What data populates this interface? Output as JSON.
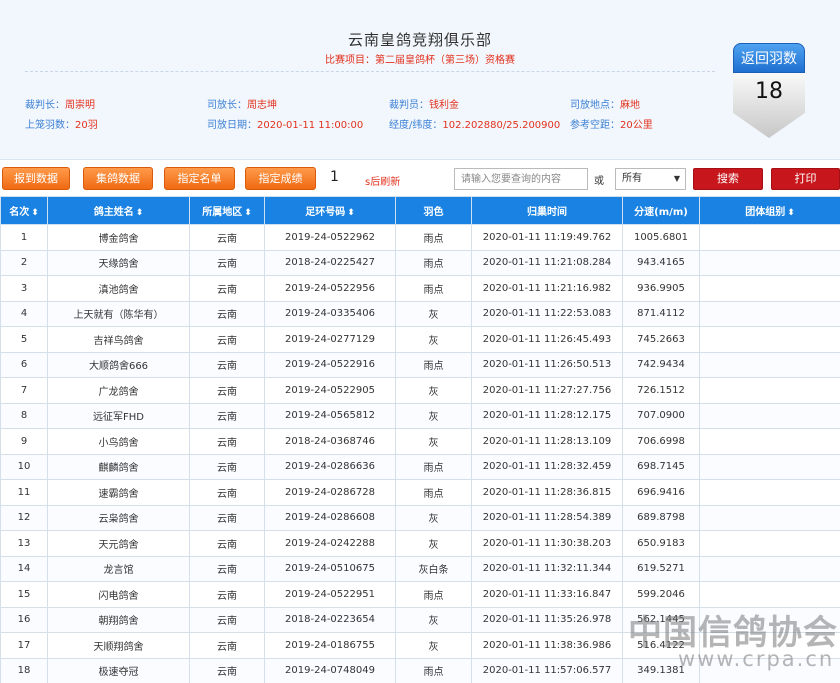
{
  "header": {
    "club_title": "云南皇鸽竞翔俱乐部",
    "race_name": "比赛项目：第二届皇鸽杯（第三场）资格赛",
    "info_row1": [
      {
        "key": "裁判长：",
        "value": "周崇明"
      },
      {
        "key": "司放长：",
        "value": "周志坤"
      },
      {
        "key": "裁判员：",
        "value": "钱利金"
      },
      {
        "key": "司放地点：",
        "value": "麻地"
      }
    ],
    "info_row2": [
      {
        "key": "上笼羽数：",
        "value": "20羽"
      },
      {
        "key": "司放日期：",
        "value": "2020-01-11 11:00:00"
      },
      {
        "key": "经度/纬度：",
        "value": "102.202880/25.200900"
      },
      {
        "key": "参考空距：",
        "value": "20公里"
      }
    ]
  },
  "badge": {
    "label": "返回羽数",
    "count": "18"
  },
  "toolbar": {
    "buttons": [
      "报到数据",
      "集鸽数据",
      "指定名单",
      "指定成绩"
    ],
    "counter": "1",
    "refresh_label": "s后刷新",
    "search_placeholder": "请输入您要查询的内容",
    "or_label": "或",
    "select_value": "所有",
    "search_button": "搜索",
    "print_button": "打印"
  },
  "table": {
    "columns": [
      "名次",
      "鸽主姓名",
      "所属地区",
      "足环号码",
      "羽色",
      "归巢时间",
      "分速(m/m)",
      "团体组别"
    ],
    "sortable": [
      true,
      true,
      true,
      true,
      false,
      false,
      false,
      true
    ],
    "rows": [
      [
        "1",
        "博金鸽舍",
        "云南",
        "2019-24-0522962",
        "雨点",
        "2020-01-11 11:19:49.762",
        "1005.6801",
        ""
      ],
      [
        "2",
        "天缘鸽舍",
        "云南",
        "2018-24-0225427",
        "雨点",
        "2020-01-11 11:21:08.284",
        "943.4165",
        ""
      ],
      [
        "3",
        "滇池鸽舍",
        "云南",
        "2019-24-0522956",
        "雨点",
        "2020-01-11 11:21:16.982",
        "936.9905",
        ""
      ],
      [
        "4",
        "上天就有（陈华有）",
        "云南",
        "2019-24-0335406",
        "灰",
        "2020-01-11 11:22:53.083",
        "871.4112",
        ""
      ],
      [
        "5",
        "吉祥鸟鸽舍",
        "云南",
        "2019-24-0277129",
        "灰",
        "2020-01-11 11:26:45.493",
        "745.2663",
        ""
      ],
      [
        "6",
        "大顺鸽舍666",
        "云南",
        "2019-24-0522916",
        "雨点",
        "2020-01-11 11:26:50.513",
        "742.9434",
        ""
      ],
      [
        "7",
        "广龙鸽舍",
        "云南",
        "2019-24-0522905",
        "灰",
        "2020-01-11 11:27:27.756",
        "726.1512",
        ""
      ],
      [
        "8",
        "远征军FHD",
        "云南",
        "2019-24-0565812",
        "灰",
        "2020-01-11 11:28:12.175",
        "707.0900",
        ""
      ],
      [
        "9",
        "小鸟鸽舍",
        "云南",
        "2018-24-0368746",
        "灰",
        "2020-01-11 11:28:13.109",
        "706.6998",
        ""
      ],
      [
        "10",
        "麒麟鸽舍",
        "云南",
        "2019-24-0286636",
        "雨点",
        "2020-01-11 11:28:32.459",
        "698.7145",
        ""
      ],
      [
        "11",
        "速霸鸽舍",
        "云南",
        "2019-24-0286728",
        "雨点",
        "2020-01-11 11:28:36.815",
        "696.9416",
        ""
      ],
      [
        "12",
        "云枭鸽舍",
        "云南",
        "2019-24-0286608",
        "灰",
        "2020-01-11 11:28:54.389",
        "689.8798",
        ""
      ],
      [
        "13",
        "天元鸽舍",
        "云南",
        "2019-24-0242288",
        "灰",
        "2020-01-11 11:30:38.203",
        "650.9183",
        ""
      ],
      [
        "14",
        "龙言馆",
        "云南",
        "2019-24-0510675",
        "灰白条",
        "2020-01-11 11:32:11.344",
        "619.5271",
        ""
      ],
      [
        "15",
        "闪电鸽舍",
        "云南",
        "2019-24-0522951",
        "雨点",
        "2020-01-11 11:33:16.847",
        "599.2046",
        ""
      ],
      [
        "16",
        "朝翔鸽舍",
        "云南",
        "2018-24-0223654",
        "灰",
        "2020-01-11 11:35:26.978",
        "562.1445",
        ""
      ],
      [
        "17",
        "天顺翔鸽舍",
        "云南",
        "2019-24-0186755",
        "灰",
        "2020-01-11 11:38:36.986",
        "516.4122",
        ""
      ],
      [
        "18",
        "极速夺冠",
        "云南",
        "2019-24-0748049",
        "雨点",
        "2020-01-11 11:57:06.577",
        "349.1381",
        ""
      ]
    ]
  },
  "watermark": {
    "line1": "中国信鸽协会",
    "line2": "www.crpa.cn"
  },
  "colors": {
    "accent_blue": "#1a82e2",
    "orange_button": "#f06a12",
    "red_button": "#c8171c",
    "label_blue": "#3b7fd4",
    "value_red": "#e2311d"
  }
}
